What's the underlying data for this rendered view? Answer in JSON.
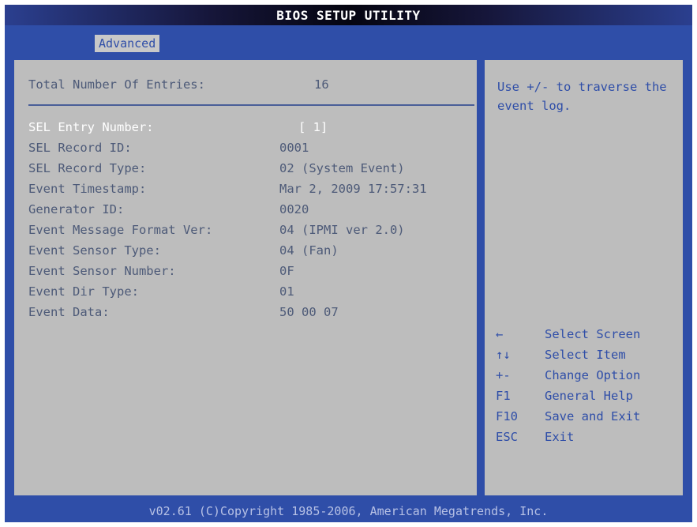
{
  "app": {
    "title": "BIOS SETUP UTILITY"
  },
  "tabs": {
    "active_label": "Advanced"
  },
  "total_entries": {
    "label": "Total Number Of Entries:",
    "value": "16"
  },
  "sel_entry": {
    "label": "SEL Entry Number:",
    "value": "[ 1]"
  },
  "records": [
    {
      "label": "SEL Record ID:",
      "value": "0001"
    },
    {
      "label": "SEL Record Type:",
      "value": "02 (System Event)"
    },
    {
      "label": "Event Timestamp:",
      "value": "Mar 2, 2009 17:57:31"
    },
    {
      "label": "Generator ID:",
      "value": "0020"
    },
    {
      "label": "Event Message Format Ver:",
      "value": "04 (IPMI ver 2.0)"
    },
    {
      "label": "Event Sensor Type:",
      "value": "04 (Fan)"
    },
    {
      "label": "Event Sensor Number:",
      "value": "0F"
    },
    {
      "label": "Event Dir Type:",
      "value": "01"
    },
    {
      "label": "Event Data:",
      "value": "50 00 07"
    }
  ],
  "help": {
    "text": "Use +/- to traverse the event log."
  },
  "key_legend": [
    {
      "key": "←",
      "action": "Select Screen"
    },
    {
      "key": "↑↓",
      "action": "Select Item"
    },
    {
      "key": "+-",
      "action": "Change Option"
    },
    {
      "key": "F1",
      "action": "General Help"
    },
    {
      "key": "F10",
      "action": "Save and Exit"
    },
    {
      "key": "ESC",
      "action": "Exit"
    }
  ],
  "footer": {
    "text": "v02.61 (C)Copyright 1985-2006, American Megatrends, Inc."
  },
  "colors": {
    "screen_blue": "#2f4ea8",
    "panel_gray": "#bdbdbd",
    "text_gray": "#4d5a78",
    "highlight_white": "#ffffff"
  }
}
